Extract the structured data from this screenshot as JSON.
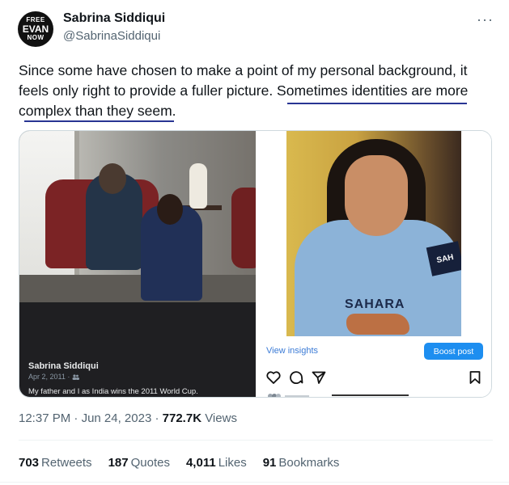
{
  "author": {
    "avatar_lines": [
      "FREE",
      "EVAN",
      "NOW"
    ],
    "display_name": "Sabrina Siddiqui",
    "handle": "@SabrinaSiddiqui",
    "more_glyph": "···"
  },
  "tweet": {
    "text": "Since some have chosen to make a point of my personal background, it feels only right to provide a fuller picture. Sometimes identities are more complex than they seem."
  },
  "media": {
    "left_post": {
      "name": "Sabrina Siddiqui",
      "meta": "Apr 2, 2011 · ",
      "caption": "My father and I as India wins the 2011 World Cup."
    },
    "right_post": {
      "band_text": "SAH",
      "logo_text": "SAHARA",
      "view_insights": "View insights",
      "boost_post": "Boost post"
    }
  },
  "footer": {
    "time": "12:37 PM",
    "date": "Jun 24, 2023",
    "views_count": "772.7K",
    "views_label": "Views",
    "separator": " · ",
    "retweets_count": "703",
    "retweets_label": "Retweets",
    "quotes_count": "187",
    "quotes_label": "Quotes",
    "likes_count": "4,011",
    "likes_label": "Likes",
    "bookmarks_count": "91",
    "bookmarks_label": "Bookmarks"
  },
  "colors": {
    "text": "#0f1419",
    "secondary": "#536471",
    "underline": "#283593",
    "boost": "#1d8ef0",
    "insights": "#3b7bd6"
  },
  "icons": [
    "more-icon",
    "heart-icon",
    "comment-icon",
    "share-icon",
    "bookmark-icon",
    "people-icon"
  ]
}
